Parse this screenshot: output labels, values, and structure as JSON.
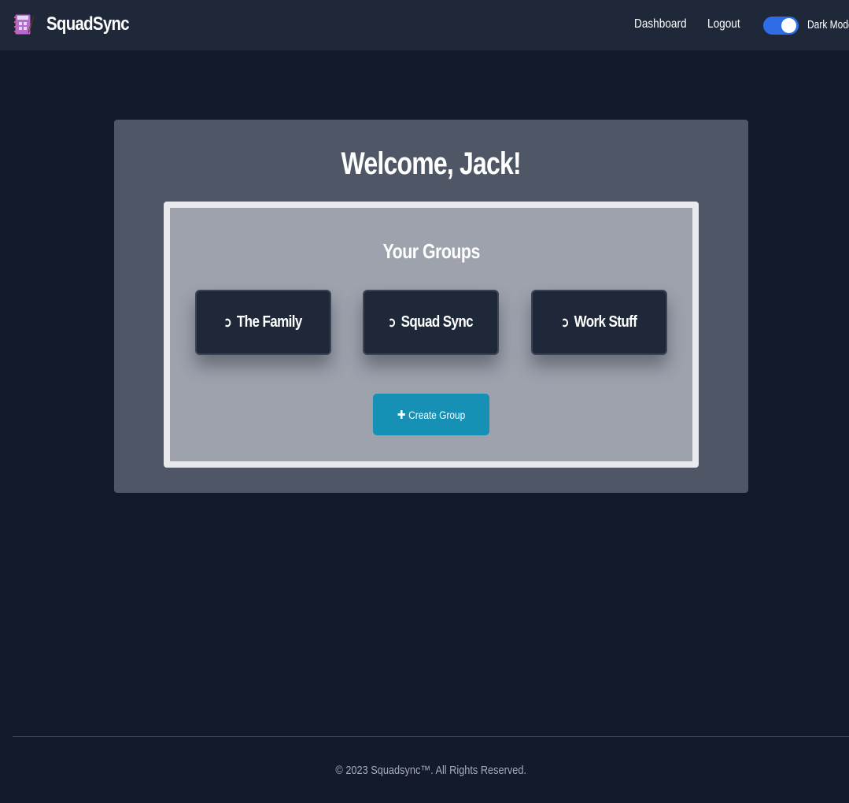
{
  "navbar": {
    "brand": "SquadSync",
    "logo_icon": "planner-notebook-icon",
    "links": {
      "dashboard": "Dashboard",
      "logout": "Logout"
    },
    "dark_mode": {
      "label": "Dark Mode",
      "enabled": true
    }
  },
  "main": {
    "welcome": "Welcome, Jack!",
    "groups_title": "Your Groups",
    "groups": [
      {
        "label": "The Family",
        "icon": "arrow-turn-icon"
      },
      {
        "label": "Squad Sync",
        "icon": "arrow-turn-icon"
      },
      {
        "label": "Work Stuff",
        "icon": "arrow-turn-icon"
      }
    ],
    "create_group": {
      "label": "Create Group",
      "icon": "plus-icon"
    }
  },
  "footer": {
    "text": "© 2023 Squadsync™. All Rights Reserved."
  },
  "colors": {
    "background": "#121a2b",
    "navbar": "#1f2839",
    "card": "#4f5766",
    "panel": "#9ea2ad",
    "group_button": "#1f2839",
    "create_button": "#1691b5",
    "toggle": "#2e6de6"
  }
}
